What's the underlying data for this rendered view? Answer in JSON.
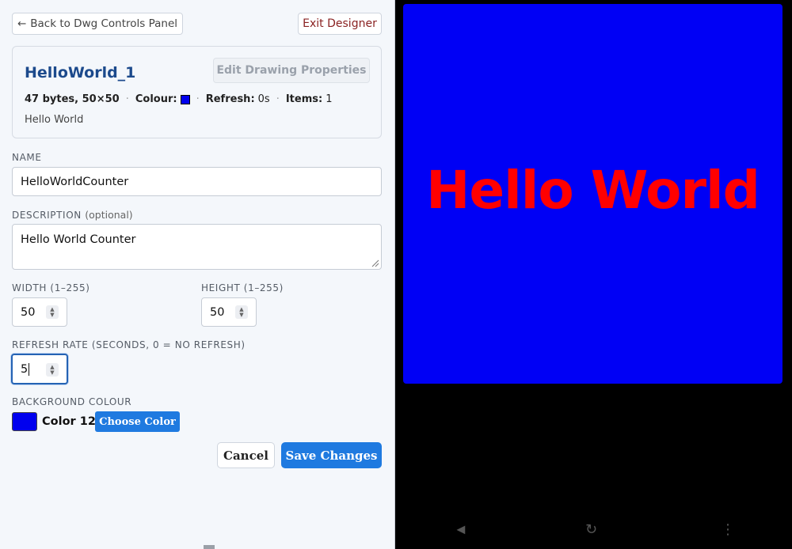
{
  "header": {
    "back_label": "Back to Dwg Controls Panel",
    "back_arrow": "←",
    "exit_label": "Exit Designer"
  },
  "summary": {
    "title": "HelloWorld_1",
    "edit_label": "Edit Drawing Properties",
    "size_text": "47 bytes, 50×50",
    "colour_label": "Colour:",
    "colour_hex": "#0000ee",
    "refresh_label": "Refresh:",
    "refresh_value": "0s",
    "items_label": "Items:",
    "items_value": "1",
    "description": "Hello World",
    "separator": "·"
  },
  "form": {
    "name_label": "NAME",
    "name_value": "HelloWorldCounter",
    "description_label": "DESCRIPTION",
    "description_optional": "(optional)",
    "description_value": "Hello World Counter",
    "width_label": "WIDTH (1–255)",
    "width_value": "50",
    "height_label": "HEIGHT (1–255)",
    "height_value": "50",
    "refresh_label": "REFRESH RATE (SECONDS, 0 = NO REFRESH)",
    "refresh_value": "5",
    "bg_label": "BACKGROUND COLOUR",
    "bg_colour_name": "Color 12",
    "bg_colour_hex": "#0000ee",
    "choose_label": "Choose Color",
    "cancel_label": "Cancel",
    "save_label": "Save Changes"
  },
  "preview": {
    "text": "Hello World",
    "background": "#0000f5",
    "text_color": "#ff0000"
  },
  "navbar": {
    "back_icon": "◄",
    "rotate_icon": "↻",
    "menu_icon": "⋮"
  },
  "colors": {
    "accent": "#1f7ae0",
    "title": "#1c4a8c",
    "exit": "#8a2222"
  }
}
